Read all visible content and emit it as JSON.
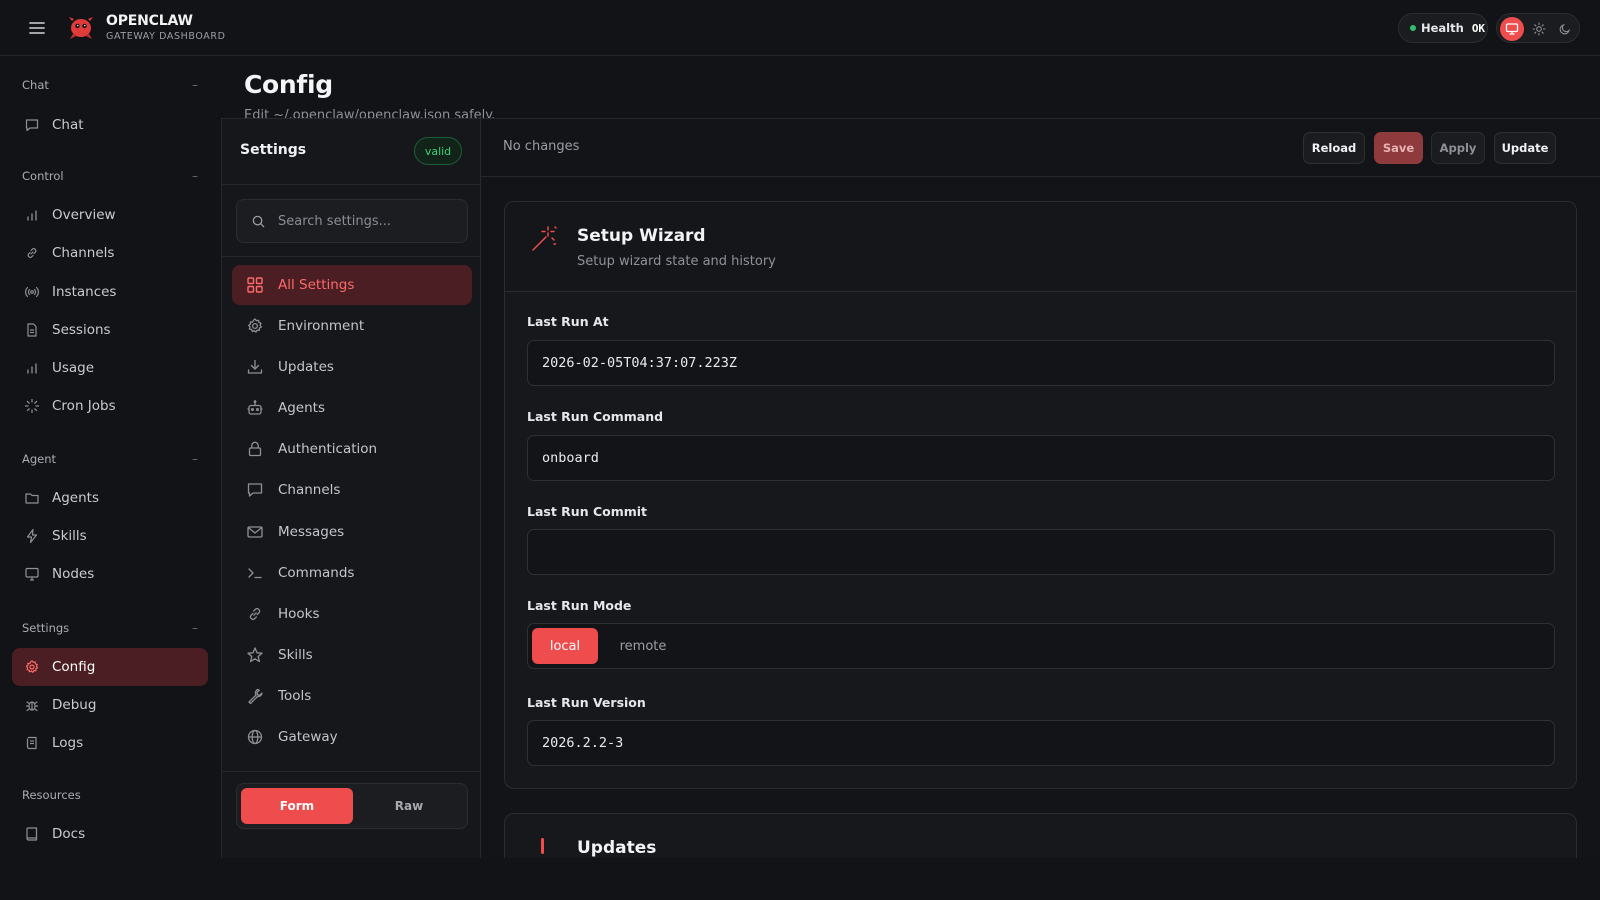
{
  "app": {
    "brand_title": "OPENCLAW",
    "brand_subtitle": "GATEWAY DASHBOARD",
    "health_label": "Health",
    "health_value": "OK"
  },
  "colors": {
    "accent": "#ef4d4d",
    "accent_dark": "#4a1e22",
    "background": "#121316",
    "valid_green": "#3fcf78",
    "health_green": "#2ec26a"
  },
  "nav": {
    "groups": [
      {
        "label": "Chat",
        "items": [
          {
            "label": "Chat",
            "icon": "message-icon"
          }
        ]
      },
      {
        "label": "Control",
        "items": [
          {
            "label": "Overview",
            "icon": "bar-chart-icon"
          },
          {
            "label": "Channels",
            "icon": "link-icon"
          },
          {
            "label": "Instances",
            "icon": "broadcast-icon"
          },
          {
            "label": "Sessions",
            "icon": "file-icon"
          },
          {
            "label": "Usage",
            "icon": "bar-chart-icon"
          },
          {
            "label": "Cron Jobs",
            "icon": "loader-icon"
          }
        ]
      },
      {
        "label": "Agent",
        "items": [
          {
            "label": "Agents",
            "icon": "folder-icon"
          },
          {
            "label": "Skills",
            "icon": "zap-icon"
          },
          {
            "label": "Nodes",
            "icon": "monitor-icon"
          }
        ]
      },
      {
        "label": "Settings",
        "items": [
          {
            "label": "Config",
            "icon": "gear-icon",
            "active": true
          },
          {
            "label": "Debug",
            "icon": "bug-icon"
          },
          {
            "label": "Logs",
            "icon": "scroll-icon"
          }
        ]
      },
      {
        "label": "Resources",
        "items": [
          {
            "label": "Docs",
            "icon": "book-icon"
          }
        ]
      }
    ]
  },
  "page": {
    "title": "Config",
    "subtitle": "Edit ~/.openclaw/openclaw.json safely."
  },
  "settings": {
    "title": "Settings",
    "status_badge": "valid",
    "search_placeholder": "Search settings...",
    "categories": [
      {
        "label": "All Settings",
        "icon": "grid-icon",
        "active": true
      },
      {
        "label": "Environment",
        "icon": "gear-icon"
      },
      {
        "label": "Updates",
        "icon": "download-icon"
      },
      {
        "label": "Agents",
        "icon": "robot-icon"
      },
      {
        "label": "Authentication",
        "icon": "lock-icon"
      },
      {
        "label": "Channels",
        "icon": "message-icon"
      },
      {
        "label": "Messages",
        "icon": "mail-icon"
      },
      {
        "label": "Commands",
        "icon": "terminal-icon"
      },
      {
        "label": "Hooks",
        "icon": "link-icon"
      },
      {
        "label": "Skills",
        "icon": "star-icon"
      },
      {
        "label": "Tools",
        "icon": "wrench-icon"
      },
      {
        "label": "Gateway",
        "icon": "globe-icon"
      }
    ],
    "mode": {
      "form_label": "Form",
      "raw_label": "Raw",
      "selected": "Form"
    }
  },
  "editor": {
    "status": "No changes",
    "buttons": {
      "reload": "Reload",
      "save": "Save",
      "apply": "Apply",
      "update": "Update"
    },
    "section": {
      "title": "Setup Wizard",
      "subtitle": "Setup wizard state and history",
      "fields": {
        "last_run_at": {
          "label": "Last Run At",
          "value": "2026-02-05T04:37:07.223Z"
        },
        "last_run_command": {
          "label": "Last Run Command",
          "value": "onboard"
        },
        "last_run_commit": {
          "label": "Last Run Commit",
          "value": ""
        },
        "last_run_mode": {
          "label": "Last Run Mode",
          "options": [
            "local",
            "remote"
          ],
          "selected": "local"
        },
        "last_run_version": {
          "label": "Last Run Version",
          "value": "2026.2.2-3"
        }
      }
    },
    "next_section_title": "Updates"
  }
}
